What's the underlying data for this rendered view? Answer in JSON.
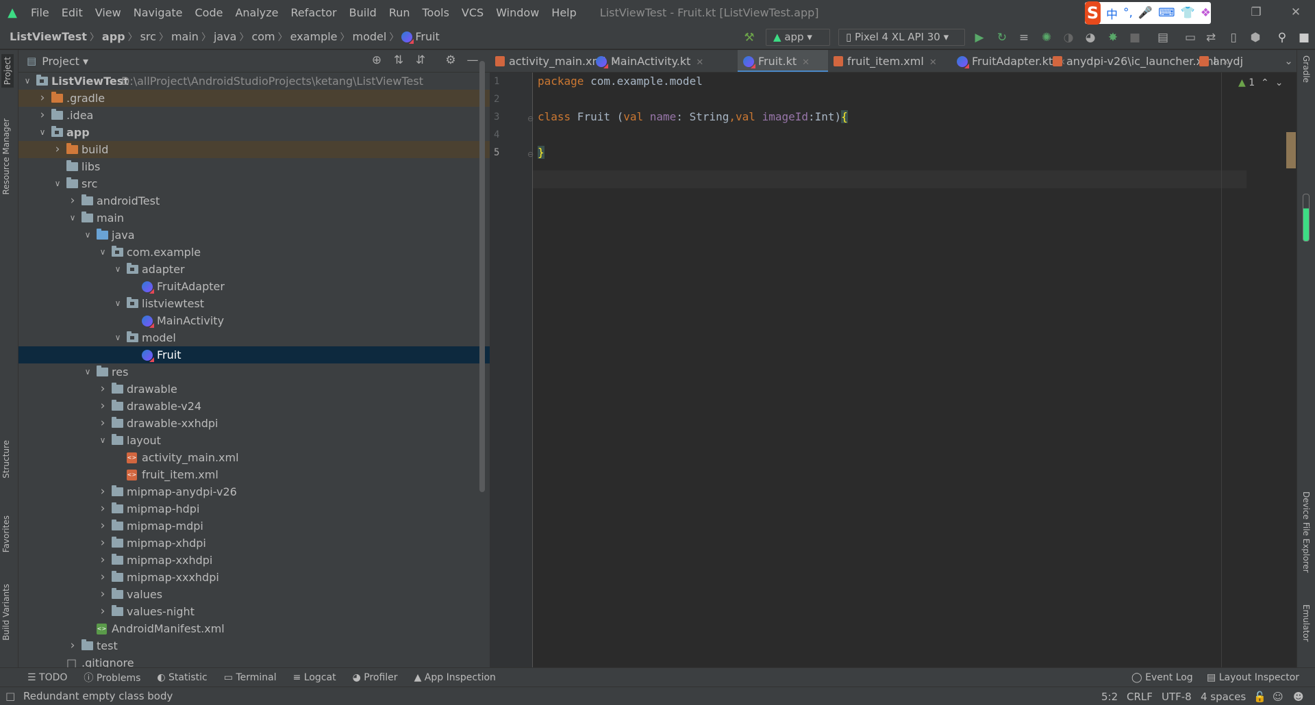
{
  "menu": {
    "items": [
      "File",
      "Edit",
      "View",
      "Navigate",
      "Code",
      "Analyze",
      "Refactor",
      "Build",
      "Run",
      "Tools",
      "VCS",
      "Window",
      "Help"
    ],
    "window_title": "ListViewTest - Fruit.kt [ListViewTest.app]"
  },
  "ime": {
    "items": [
      "中",
      "°,",
      "mic-icon",
      "keyboard-icon",
      "shirt-icon",
      "apps-icon"
    ]
  },
  "breadcrumb": [
    "ListViewTest",
    "app",
    "src",
    "main",
    "java",
    "com",
    "example",
    "model",
    "Fruit"
  ],
  "toolbar": {
    "run_config": "app",
    "device": "Pixel 4 XL API 30"
  },
  "project_panel": {
    "title": "Project"
  },
  "tree": [
    {
      "label": "ListViewTest",
      "extra": "D:\\allProject\\AndroidStudioProjects\\ketang\\ListViewTest",
      "depth": 0,
      "type": "module",
      "open": true
    },
    {
      "label": ".gradle",
      "depth": 1,
      "type": "folder-orange",
      "open": false
    },
    {
      "label": ".idea",
      "depth": 1,
      "type": "folder",
      "open": false
    },
    {
      "label": "app",
      "depth": 1,
      "type": "module",
      "open": true
    },
    {
      "label": "build",
      "depth": 2,
      "type": "folder-orange",
      "open": false
    },
    {
      "label": "libs",
      "depth": 2,
      "type": "folder",
      "leaf": true
    },
    {
      "label": "src",
      "depth": 2,
      "type": "folder",
      "open": true
    },
    {
      "label": "androidTest",
      "depth": 3,
      "type": "folder",
      "open": false
    },
    {
      "label": "main",
      "depth": 3,
      "type": "folder",
      "open": true
    },
    {
      "label": "java",
      "depth": 4,
      "type": "folder-blue",
      "open": true
    },
    {
      "label": "com.example",
      "depth": 5,
      "type": "package",
      "open": true
    },
    {
      "label": "adapter",
      "depth": 6,
      "type": "package",
      "open": true
    },
    {
      "label": "FruitAdapter",
      "depth": 7,
      "type": "kotlin",
      "leaf": true
    },
    {
      "label": "listviewtest",
      "depth": 6,
      "type": "package",
      "open": true
    },
    {
      "label": "MainActivity",
      "depth": 7,
      "type": "kotlin",
      "leaf": true
    },
    {
      "label": "model",
      "depth": 6,
      "type": "package",
      "open": true
    },
    {
      "label": "Fruit",
      "depth": 7,
      "type": "kotlin",
      "leaf": true,
      "selected": true
    },
    {
      "label": "res",
      "depth": 4,
      "type": "folder",
      "open": true
    },
    {
      "label": "drawable",
      "depth": 5,
      "type": "folder",
      "open": false
    },
    {
      "label": "drawable-v24",
      "depth": 5,
      "type": "folder",
      "open": false
    },
    {
      "label": "drawable-xxhdpi",
      "depth": 5,
      "type": "folder",
      "open": false
    },
    {
      "label": "layout",
      "depth": 5,
      "type": "folder",
      "open": true
    },
    {
      "label": "activity_main.xml",
      "depth": 6,
      "type": "xml",
      "leaf": true
    },
    {
      "label": "fruit_item.xml",
      "depth": 6,
      "type": "xml",
      "leaf": true
    },
    {
      "label": "mipmap-anydpi-v26",
      "depth": 5,
      "type": "folder",
      "open": false
    },
    {
      "label": "mipmap-hdpi",
      "depth": 5,
      "type": "folder",
      "open": false
    },
    {
      "label": "mipmap-mdpi",
      "depth": 5,
      "type": "folder",
      "open": false
    },
    {
      "label": "mipmap-xhdpi",
      "depth": 5,
      "type": "folder",
      "open": false
    },
    {
      "label": "mipmap-xxhdpi",
      "depth": 5,
      "type": "folder",
      "open": false
    },
    {
      "label": "mipmap-xxxhdpi",
      "depth": 5,
      "type": "folder",
      "open": false
    },
    {
      "label": "values",
      "depth": 5,
      "type": "folder",
      "open": false
    },
    {
      "label": "values-night",
      "depth": 5,
      "type": "folder",
      "open": false
    },
    {
      "label": "AndroidManifest.xml",
      "depth": 4,
      "type": "manifest",
      "leaf": true
    },
    {
      "label": "test",
      "depth": 3,
      "type": "folder",
      "open": false
    },
    {
      "label": ".gitignore",
      "depth": 2,
      "type": "file",
      "leaf": true
    }
  ],
  "tabs": [
    {
      "label": "activity_main.xml",
      "icon": "xml"
    },
    {
      "label": "MainActivity.kt",
      "icon": "kotlin"
    },
    {
      "label": "Fruit.kt",
      "icon": "kotlin",
      "active": true
    },
    {
      "label": "fruit_item.xml",
      "icon": "xml"
    },
    {
      "label": "FruitAdapter.kt",
      "icon": "kotlin"
    },
    {
      "label": "anydpi-v26\\ic_launcher.xml",
      "icon": "xml"
    },
    {
      "label": "anydj",
      "icon": "xml"
    }
  ],
  "editor": {
    "line_numbers": [
      "1",
      "2",
      "3",
      "4",
      "5"
    ],
    "current_line": 5,
    "warnings": "1"
  },
  "left_strip": [
    "Project",
    "Resource Manager",
    "Structure",
    "Favorites",
    "Build Variants"
  ],
  "right_strip": [
    "Gradle",
    "Device File Explorer",
    "Emulator"
  ],
  "bottom_tools": [
    "TODO",
    "Problems",
    "Statistic",
    "Terminal",
    "Logcat",
    "Profiler",
    "App Inspection"
  ],
  "bottom_right_tools": [
    "Event Log",
    "Layout Inspector"
  ],
  "status": {
    "message": "Redundant empty class body",
    "position": "5:2",
    "line_sep": "CRLF",
    "encoding": "UTF-8",
    "indent": "4 spaces"
  },
  "colors": {
    "bg": "#2b2b2b",
    "panel": "#3c3f41",
    "selection": "#0d293e",
    "accent": "#4a88c7",
    "keyword": "#cc7832",
    "property": "#9876aa"
  }
}
